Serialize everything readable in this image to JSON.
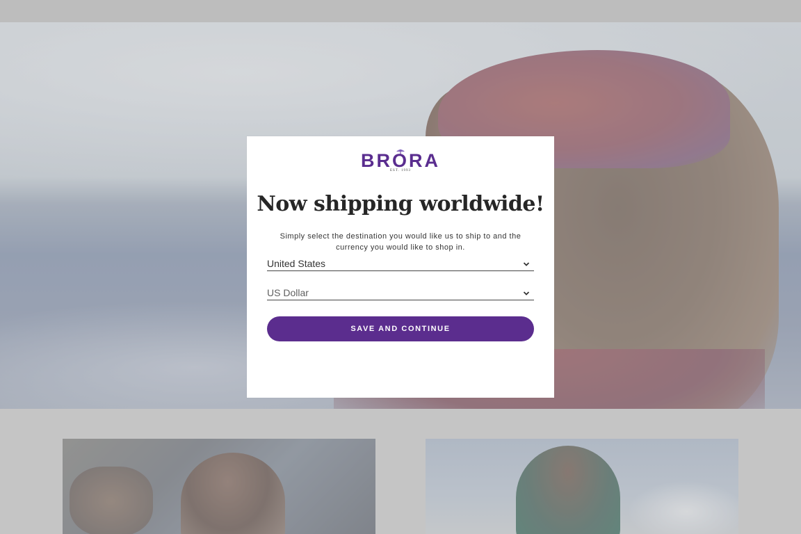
{
  "brand": {
    "name": "BRORA",
    "est_label": "EST. 1993",
    "color": "#5b2d8e"
  },
  "modal": {
    "title": "Now shipping worldwide!",
    "subtitle": "Simply select the destination you would like us to ship to and the currency you would like to shop in.",
    "country_select": {
      "value": "United States",
      "icon": "chevron-down-icon"
    },
    "currency_select": {
      "value": "US Dollar",
      "icon": "chevron-down-icon"
    },
    "save_button_label": "SAVE AND CONTINUE"
  },
  "colors": {
    "button_bg": "#5b2d8e",
    "button_text": "#ffffff",
    "modal_bg": "#ffffff",
    "title_text": "#262626"
  }
}
